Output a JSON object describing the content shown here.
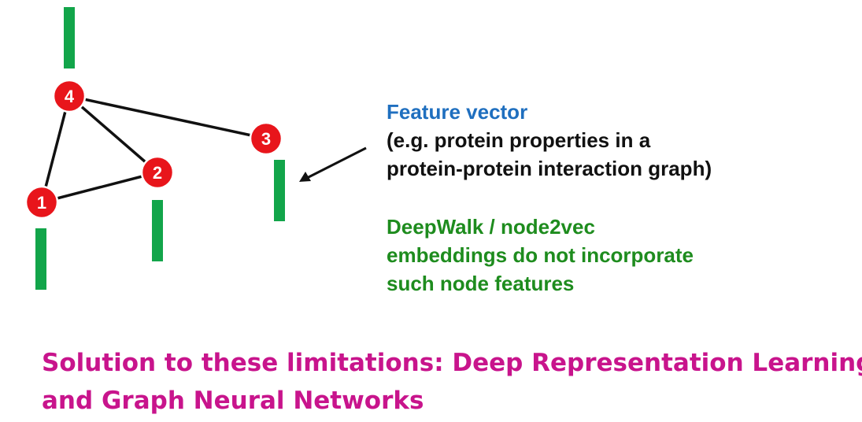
{
  "graph": {
    "nodes": [
      {
        "id": "4",
        "label": "4"
      },
      {
        "id": "3",
        "label": "3"
      },
      {
        "id": "2",
        "label": "2"
      },
      {
        "id": "1",
        "label": "1"
      }
    ],
    "edges": [
      [
        "4",
        "3"
      ],
      [
        "4",
        "2"
      ],
      [
        "4",
        "1"
      ],
      [
        "1",
        "2"
      ]
    ],
    "node_color": "#e8151b",
    "feature_bar_color": "#12a54a"
  },
  "feature_text": {
    "heading": "Feature vector",
    "line1": "(e.g. protein properties in a",
    "line2": "protein-protein interaction graph)"
  },
  "deepwalk_text": {
    "line1": "DeepWalk / node2vec",
    "line2": "embeddings do not incorporate",
    "line3": "such node features"
  },
  "solution": {
    "line1": "Solution to these limitations: Deep Representation Learning",
    "line2": "and Graph Neural Networks"
  },
  "colors": {
    "heading_blue": "#1f6fbf",
    "deepwalk_green": "#1e8c1e",
    "solution_magenta": "#c8148c"
  }
}
